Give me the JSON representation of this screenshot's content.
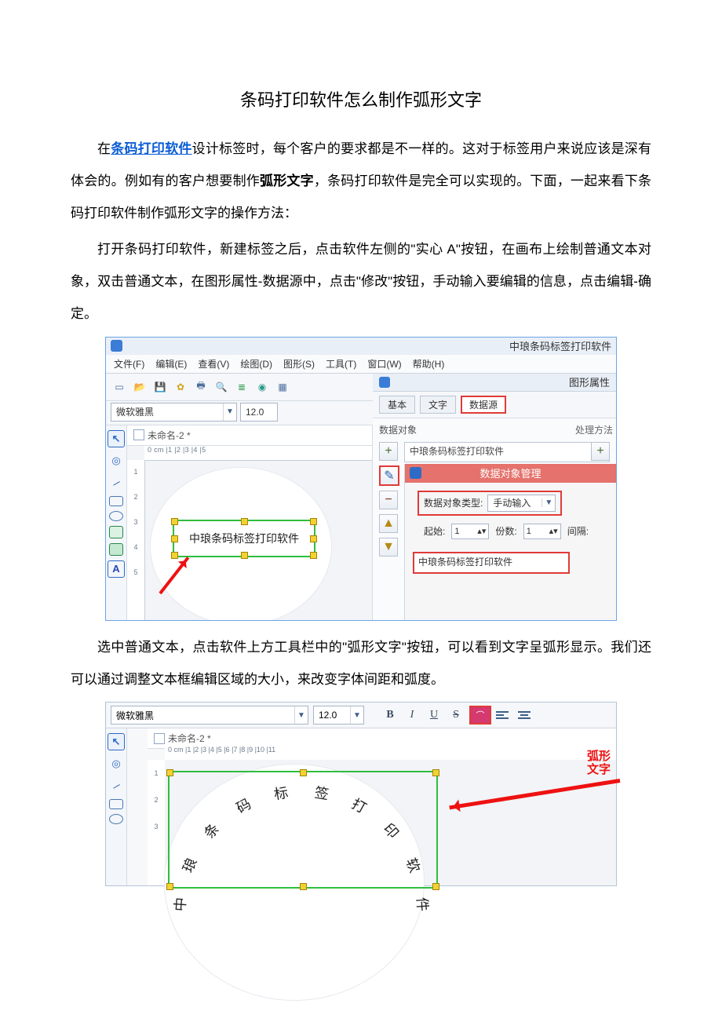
{
  "doc": {
    "title": "条码打印软件怎么制作弧形文字",
    "p1_a": "在",
    "p1_link": "条码打印软件",
    "p1_b": "设计标签时，每个客户的要求都是不一样的。这对于标签用户来说应该是深有体会的。例如有的客户想要制作",
    "p1_bold": "弧形文字",
    "p1_c": "，条码打印软件是完全可以实现的。下面，一起来看下条码打印软件制作弧形文字的操作方法：",
    "p2": "打开条码打印软件，新建标签之后，点击软件左侧的\"实心 A\"按钮，在画布上绘制普通文本对象，双击普通文本，在图形属性-数据源中，点击\"修改\"按钮，手动输入要编辑的信息，点击编辑-确定。",
    "p3": "选中普通文本，点击软件上方工具栏中的\"弧形文字\"按钮，可以看到文字呈弧形显示。我们还可以通过调整文本框编辑区域的大小，来改变字体间距和弧度。"
  },
  "shot1": {
    "app_title": "中琅条码标签打印软件",
    "menu": {
      "file": "文件(F)",
      "edit": "编辑(E)",
      "view": "查看(V)",
      "draw": "绘图(D)",
      "shape": "图形(S)",
      "tool": "工具(T)",
      "window": "窗口(W)",
      "help": "帮助(H)"
    },
    "font_name": "微软雅黑",
    "font_size": "12.0",
    "doc_name": "未命名-2 *",
    "hruler": "0 cm |1    |2    |3    |4    |5",
    "vruler": [
      "1",
      "2",
      "3",
      "4",
      "5"
    ],
    "canvas_text": "中琅条码标签打印软件",
    "prop": {
      "title": "图形属性",
      "tab_base": "基本",
      "tab_text": "文字",
      "tab_data": "数据源",
      "data_obj_label": "数据对象",
      "proc_label": "处理方法",
      "data_entry": "中琅条码标签打印软件",
      "dialog_title": "数据对象管理",
      "type_label": "数据对象类型:",
      "type_value": "手动输入",
      "start_label": "起始:",
      "start_value": "1",
      "count_label": "份数:",
      "count_value": "1",
      "gap_label": "间隔:",
      "editor_value": "中琅条码标签打印软件"
    }
  },
  "shot2": {
    "font_name": "微软雅黑",
    "font_size": "12.0",
    "doc_name": "未命名-2 *",
    "hruler": "0 cm |1    |2    |3    |4    |5    |6    |7    |8    |9    |10   |11",
    "vruler": [
      "1",
      "2",
      "3"
    ],
    "arc_label": "弧形文字",
    "arc_chars": [
      "中",
      "琅",
      "条",
      "码",
      "标",
      "签",
      "打",
      "印",
      "软",
      "件"
    ]
  }
}
